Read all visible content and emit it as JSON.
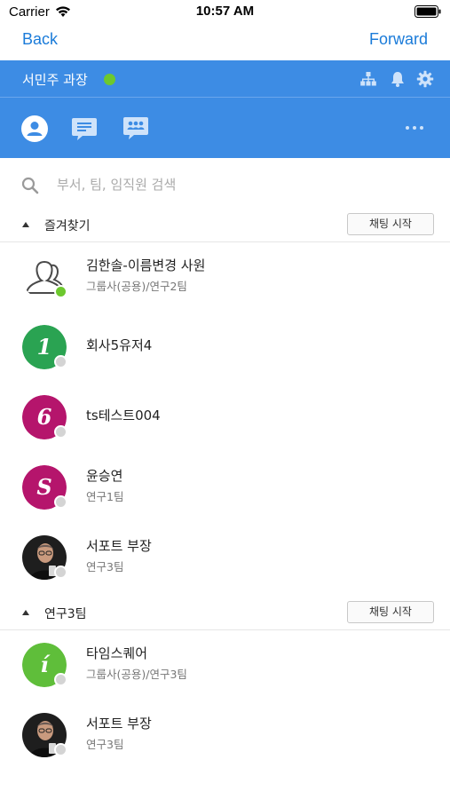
{
  "status_bar": {
    "carrier": "Carrier",
    "time": "10:57 AM"
  },
  "nav": {
    "back_label": "Back",
    "forward_label": "Forward"
  },
  "header": {
    "user_name": "서민주 과장",
    "presence_color": "#6dc82e",
    "icons": [
      "org-chart-icon",
      "bell-icon",
      "gear-icon"
    ],
    "tabs": [
      "person-icon",
      "chat-bubble-icon",
      "group-chat-icon"
    ],
    "accent_color": "#3d8ce4"
  },
  "search": {
    "placeholder": "부서, 팀, 임직원 검색"
  },
  "sections": [
    {
      "title": "즐겨찾기",
      "button_label": "채팅 시작",
      "contacts": [
        {
          "name": "김한솔-이름변경 사원",
          "dept": "그룹사(공용)/연구2팀",
          "avatar": "outline",
          "status": "online"
        },
        {
          "name": "회사5유저4",
          "dept": "",
          "avatar_letter": "1",
          "avatar_color": "#2aa352",
          "status": "offline"
        },
        {
          "name": "ts테스트004",
          "dept": "",
          "avatar_letter": "6",
          "avatar_color": "#b5156c",
          "status": "offline"
        },
        {
          "name": "윤승연",
          "dept": "연구1팀",
          "avatar_letter": "S",
          "avatar_color": "#b5156c",
          "status": "offline"
        },
        {
          "name": "서포트 부장",
          "dept": "연구3팀",
          "avatar": "photo",
          "status": "offline"
        }
      ]
    },
    {
      "title": "연구3팀",
      "button_label": "채팅 시작",
      "contacts": [
        {
          "name": "타임스퀘어",
          "dept": "그룹사(공용)/연구3팀",
          "avatar_letter": "í",
          "avatar_color": "#5fbe3a",
          "status": "offline"
        },
        {
          "name": "서포트 부장",
          "dept": "연구3팀",
          "avatar": "photo",
          "status": "offline"
        }
      ]
    }
  ]
}
